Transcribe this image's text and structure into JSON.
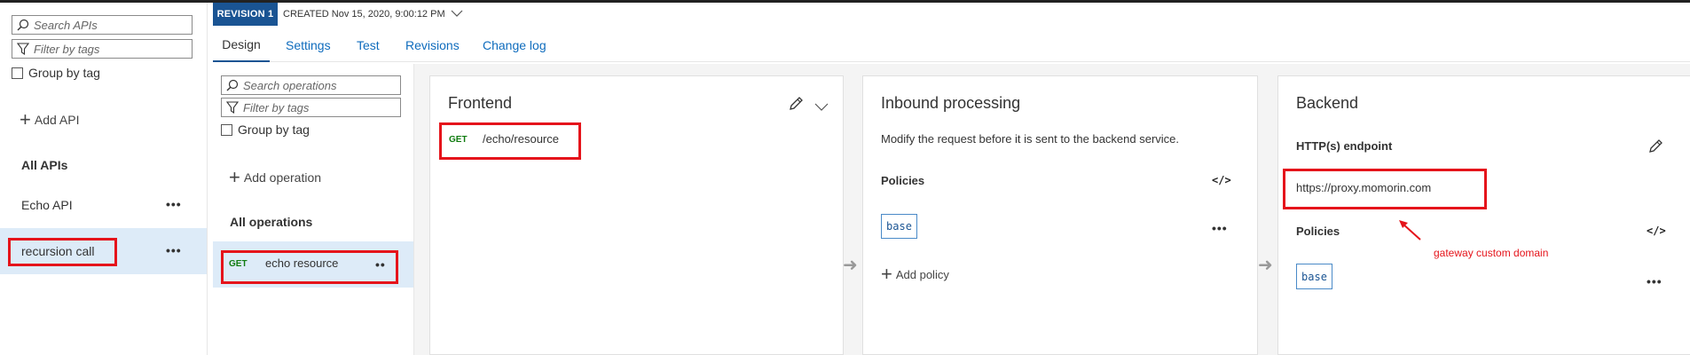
{
  "apis_panel": {
    "search_placeholder": "Search APIs",
    "filter_placeholder": "Filter by tags",
    "group_by_tag": "Group by tag",
    "add_api": "Add API",
    "all_apis": "All APIs",
    "apis": [
      {
        "name": "Echo API",
        "selected": false
      },
      {
        "name": "recursion call",
        "selected": true
      }
    ]
  },
  "revision": {
    "badge": "REVISION 1",
    "created": "CREATED Nov 15, 2020, 9:00:12 PM"
  },
  "tabs": [
    {
      "label": "Design",
      "active": true
    },
    {
      "label": "Settings",
      "active": false
    },
    {
      "label": "Test",
      "active": false
    },
    {
      "label": "Revisions",
      "active": false
    },
    {
      "label": "Change log",
      "active": false
    }
  ],
  "operations_panel": {
    "search_placeholder": "Search operations",
    "filter_placeholder": "Filter by tags",
    "group_by_tag": "Group by tag",
    "add_operation": "Add operation",
    "all_operations": "All operations",
    "operations": [
      {
        "method": "GET",
        "name": "echo resource",
        "selected": true
      }
    ]
  },
  "frontend": {
    "title": "Frontend",
    "method": "GET",
    "path": "/echo/resource"
  },
  "inbound": {
    "title": "Inbound processing",
    "description": "Modify the request before it is sent to the backend service.",
    "policies_label": "Policies",
    "base_label": "base",
    "add_policy": "Add policy"
  },
  "backend": {
    "title": "Backend",
    "endpoint_label": "HTTP(s) endpoint",
    "endpoint_url": "https://proxy.momorin.com",
    "policies_label": "Policies",
    "base_label": "base"
  },
  "annotation": {
    "text": "gateway custom domain"
  },
  "colors": {
    "accent": "#1a5493",
    "link": "#0f6cbd",
    "highlight_box": "#e5141b",
    "selected_row": "#ddebf8",
    "get_method": "#107c10"
  }
}
